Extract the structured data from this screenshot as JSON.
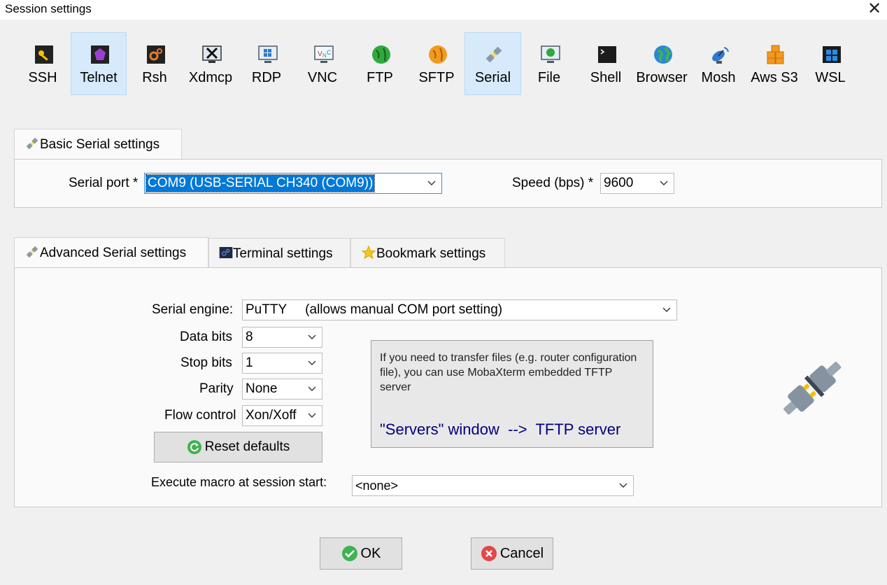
{
  "window": {
    "title": "Session settings",
    "close": "✕"
  },
  "session_types": [
    {
      "label": "SSH",
      "icon": "ssh-key-icon"
    },
    {
      "label": "Telnet",
      "icon": "telnet-icon"
    },
    {
      "label": "Rsh",
      "icon": "rsh-icon"
    },
    {
      "label": "Xdmcp",
      "icon": "xdmcp-icon"
    },
    {
      "label": "RDP",
      "icon": "rdp-monitor-icon"
    },
    {
      "label": "VNC",
      "icon": "vnc-icon"
    },
    {
      "label": "FTP",
      "icon": "ftp-globe-icon"
    },
    {
      "label": "SFTP",
      "icon": "sftp-globe-icon"
    },
    {
      "label": "Serial",
      "icon": "serial-plug-icon"
    },
    {
      "label": "File",
      "icon": "file-monitor-icon"
    },
    {
      "label": "Shell",
      "icon": "shell-terminal-icon"
    },
    {
      "label": "Browser",
      "icon": "browser-globe-icon"
    },
    {
      "label": "Mosh",
      "icon": "mosh-satellite-icon"
    },
    {
      "label": "Aws S3",
      "icon": "aws-s3-cubes-icon"
    },
    {
      "label": "WSL",
      "icon": "wsl-windows-icon"
    }
  ],
  "selected_type": "Serial",
  "basic": {
    "tab_label": "Basic Serial settings",
    "serial_port_label": "Serial port *",
    "serial_port_value": "COM9  (USB-SERIAL CH340 (COM9))",
    "speed_label": "Speed (bps) *",
    "speed_value": "9600"
  },
  "advanced_tabs": [
    {
      "label": "Advanced Serial settings",
      "icon": "plug-icon",
      "active": true
    },
    {
      "label": "Terminal settings",
      "icon": "terminal-icon",
      "active": false
    },
    {
      "label": "Bookmark settings",
      "icon": "star-icon",
      "active": false
    }
  ],
  "advanced": {
    "engine_label": "Serial engine:",
    "engine_value": "PuTTY     (allows manual COM port setting)",
    "data_bits_label": "Data bits",
    "data_bits_value": "8",
    "stop_bits_label": "Stop bits",
    "stop_bits_value": "1",
    "parity_label": "Parity",
    "parity_value": "None",
    "flow_label": "Flow control",
    "flow_value": "Xon/Xoff",
    "reset_label": "Reset defaults",
    "macro_label": "Execute macro at session start:",
    "macro_value": "<none>",
    "info_text": "If you need to transfer files (e.g. router configuration file), you can use MobaXterm embedded TFTP server",
    "info_link": "\"Servers\" window  -->  TFTP server"
  },
  "buttons": {
    "ok": "OK",
    "cancel": "Cancel"
  },
  "colors": {
    "selected_bg": "#d7eafb",
    "focus_blue": "#0078d7",
    "link_navy": "#00007f",
    "ok_green": "#3fb34f",
    "cancel_red": "#e34848"
  }
}
